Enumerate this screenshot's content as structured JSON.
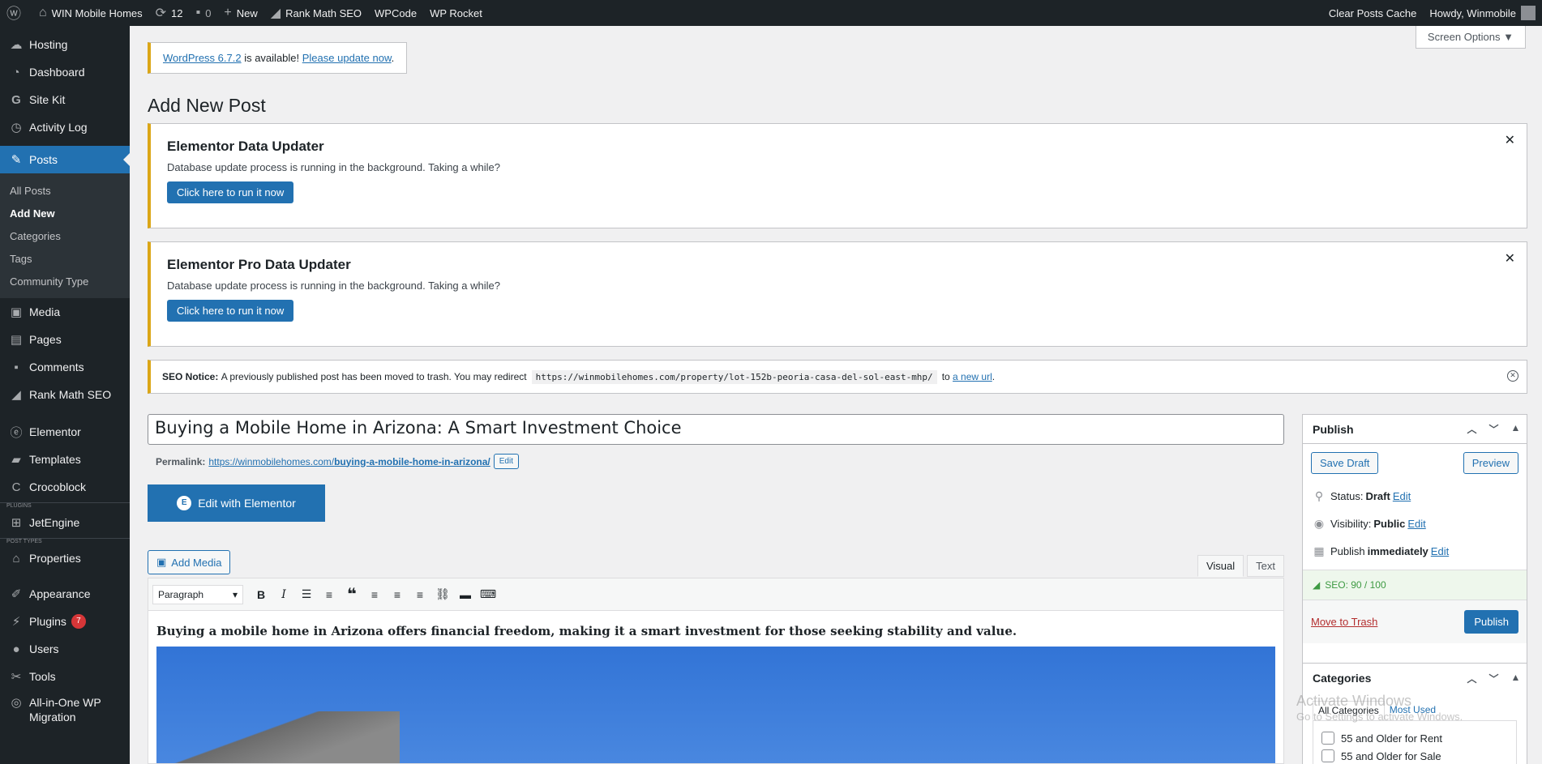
{
  "adminbar": {
    "site_name": "WIN Mobile Homes",
    "updates": "12",
    "comments": "0",
    "new_label": "New",
    "rank_math": "Rank Math SEO",
    "wpcode": "WPCode",
    "wprocket": "WP Rocket",
    "clear_cache": "Clear Posts Cache",
    "howdy": "Howdy, Winmobile"
  },
  "sidebar": {
    "items_top": [
      "Hosting",
      "Dashboard",
      "Site Kit",
      "Activity Log"
    ],
    "posts": "Posts",
    "submenu": [
      "All Posts",
      "Add New",
      "Categories",
      "Tags",
      "Community Type"
    ],
    "items_mid": [
      "Media",
      "Pages",
      "Comments",
      "Rank Math SEO"
    ],
    "elementor": "Elementor",
    "templates": "Templates",
    "crocoblock": "Crocoblock",
    "sep_plugins": "PLUGINS",
    "jetengine": "JetEngine",
    "sep_post_types": "POST TYPES",
    "properties": "Properties",
    "appearance": "Appearance",
    "plugins": "Plugins",
    "plugins_badge": "7",
    "users": "Users",
    "tools": "Tools",
    "migration": "All-in-One WP Migration"
  },
  "screen_options": "Screen Options ▼",
  "update_nag": {
    "version_link": "WordPress 6.7.2",
    "middle": " is available! ",
    "update_link": "Please update now",
    "end": "."
  },
  "page_title": "Add New Post",
  "notices": [
    {
      "title": "Elementor Data Updater",
      "text": "Database update process is running in the background. Taking a while?",
      "button": "Click here to run it now"
    },
    {
      "title": "Elementor Pro Data Updater",
      "text": "Database update process is running in the background. Taking a while?",
      "button": "Click here to run it now"
    }
  ],
  "seo_notice": {
    "label": "SEO Notice:",
    "text": "A previously published post has been moved to trash. You may redirect",
    "url": "https://winmobilehomes.com/property/lot-152b-peoria-casa-del-sol-east-mhp/",
    "to": "to",
    "link": "a new url",
    "end": "."
  },
  "post": {
    "title": "Buying a Mobile Home in Arizona: A Smart Investment Choice",
    "permalink_label": "Permalink:",
    "permalink_base": "https://winmobilehomes.com/",
    "permalink_slug": "buying-a-mobile-home-in-arizona/",
    "edit_label": "Edit",
    "elementor_button": "Edit with Elementor",
    "add_media": "Add Media",
    "tab_visual": "Visual",
    "tab_text": "Text",
    "format": "Paragraph",
    "content": "Buying a mobile home in Arizona offers financial freedom, making it a smart investment for those seeking stability and value."
  },
  "publish": {
    "title": "Publish",
    "save_draft": "Save Draft",
    "preview": "Preview",
    "status_label": "Status:",
    "status_value": "Draft",
    "visibility_label": "Visibility:",
    "visibility_value": "Public",
    "publish_label": "Publish",
    "publish_value": "immediately",
    "edit": "Edit",
    "seo": "SEO: 90 / 100",
    "trash": "Move to Trash",
    "publish_button": "Publish"
  },
  "categories": {
    "title": "Categories",
    "tab_all": "All Categories",
    "tab_most": "Most Used",
    "items": [
      "55 and Older for Rent",
      "55 and Older for Sale"
    ]
  },
  "watermark": {
    "line1": "Activate Windows",
    "line2": "Go to Settings to activate Windows."
  }
}
